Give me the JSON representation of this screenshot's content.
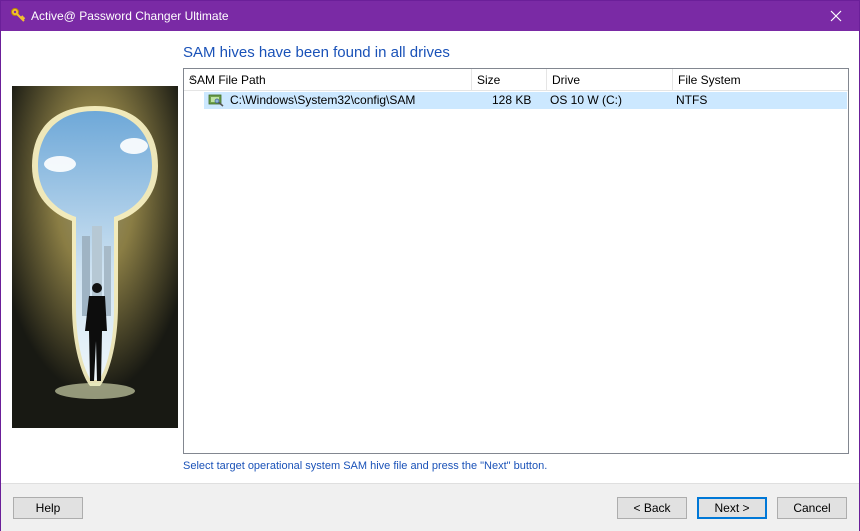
{
  "window": {
    "title": "Active@ Password Changer Ultimate",
    "accent": "#7a2aa5"
  },
  "main": {
    "heading": "SAM hives have been found in all drives",
    "hint": "Select target operational system SAM hive file and press the \"Next\" button."
  },
  "table": {
    "columns": [
      "SAM File Path",
      "Size",
      "Drive",
      "File System"
    ],
    "rows": [
      {
        "path": "C:\\Windows\\System32\\config\\SAM",
        "size": "128 KB",
        "drive": "OS 10 W (C:)",
        "fs": "NTFS",
        "icon": "hive-file-icon"
      }
    ],
    "sort_indicator": "^"
  },
  "footer": {
    "help": "Help",
    "back": "< Back",
    "next": "Next >",
    "cancel": "Cancel"
  },
  "colors": {
    "heading": "#1a52b8",
    "selection": "#cce8ff"
  }
}
